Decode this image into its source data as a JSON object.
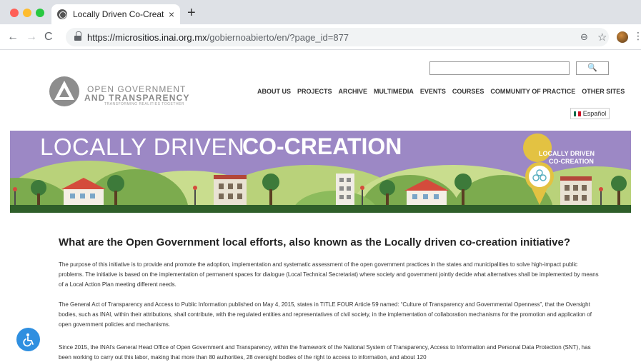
{
  "browser": {
    "tab_title": "Locally Driven Co-Creation - O",
    "tab_close": "×",
    "new_tab": "+",
    "url_host": "https://micrositios.inai.org.mx",
    "url_path": "/gobiernoabierto/en/?page_id=877"
  },
  "site": {
    "search": {
      "placeholder": "",
      "button_label": "🔍"
    },
    "logo": {
      "line1": "OPEN GOVERNMENT",
      "line2": "AND TRANSPARENCY",
      "line3": "TRANSFORMING REALITIES TOGETHER"
    },
    "nav": [
      "ABOUT US",
      "PROJECTS",
      "ARCHIVE",
      "MULTIMEDIA",
      "EVENTS",
      "COURSES",
      "COMMUNITY OF PRACTICE",
      "OTHER SITES"
    ],
    "language_button": "Español"
  },
  "banner": {
    "title_light": "LOCALLY DRIVEN",
    "title_bold": "CO-CREATION",
    "badge_line1": "LOCALLY DRIVEN",
    "badge_line2": "CO-CREATION"
  },
  "content": {
    "heading": "What are the Open Government local efforts, also known as the Locally driven co-creation initiative?",
    "paragraphs": [
      "The purpose of this initiative is to provide and promote the adoption, implementation and systematic assessment of the open government practices in the states and municipalities to solve high-impact public problems. The initiative is based on the implementation of permanent spaces for dialogue (Local Technical Secretariat) where society and government jointly decide what alternatives shall be implemented by means of a Local Action Plan meeting different needs.",
      "The General Act of Transparency and Access to Public Information published on May 4, 2015, states in TITLE FOUR Article 59 named: “Culture of Transparency and Governmental Openness”, that the Oversight bodies, such as INAI, within their attributions, shall contribute, with the regulated entities and representatives of civil society, in the implementation of collaboration mechanisms for the promotion and application of open government policies and mechanisms.",
      "Since 2015, the INAI's General Head Office of Open Government and Transparency, within the framework of the National System of Transparency, Access to Information and Personal Data Protection (SNT), has been working to carry out this labor, making that more than 80 authorities, 28 oversight bodies of the right to access to information, and about 120"
    ]
  },
  "colors": {
    "banner_bg": "#9c88c5",
    "hill_green": "#7cab4e",
    "ground": "#2f5f2a",
    "accessibility": "#2f8fe0"
  },
  "icons": {
    "back": "←",
    "forward": "→",
    "reload": "C",
    "zoom": "⊖",
    "star": "☆",
    "menu": "⋮"
  }
}
